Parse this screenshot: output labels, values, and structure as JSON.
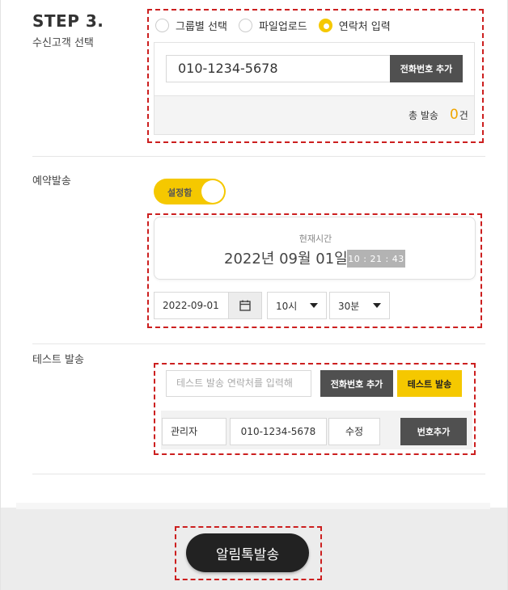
{
  "step": {
    "title": "STEP 3.",
    "subtitle": "수신고객 선택"
  },
  "recipient": {
    "options": [
      {
        "label": "그룹별 선택",
        "selected": false
      },
      {
        "label": "파일업로드",
        "selected": false
      },
      {
        "label": "연락처 입력",
        "selected": true
      }
    ],
    "phone_value": "010-1234-5678",
    "add_button": "전화번호 추가",
    "total_label": "총 발송",
    "total_count": "0",
    "total_unit": "건"
  },
  "reservation": {
    "label": "예약발송",
    "toggle_label": "설정함",
    "current_time_label": "현재시간",
    "current_date": "2022년 09월 01일",
    "current_clock": "10 : 21 : 43",
    "date_value": "2022-09-01",
    "hour_value": "10시",
    "minute_value": "30분"
  },
  "test": {
    "label": "테스트 발송",
    "input_placeholder": "테스트 발송 연락처를 입력해",
    "add_button": "전화번호 추가",
    "send_button": "테스트 발송",
    "entry_name": "관리자",
    "entry_phone": "010-1234-5678",
    "edit_button": "수정",
    "number_add_button": "번호추가"
  },
  "footer": {
    "send_button": "알림톡발송"
  },
  "colors": {
    "accent": "#f5c800",
    "count": "#f0a500",
    "dark_button": "#505050",
    "highlight_dash": "#cc1f1f"
  },
  "icons": {
    "calendar": "calendar-icon",
    "dropdown": "chevron-down-icon"
  }
}
